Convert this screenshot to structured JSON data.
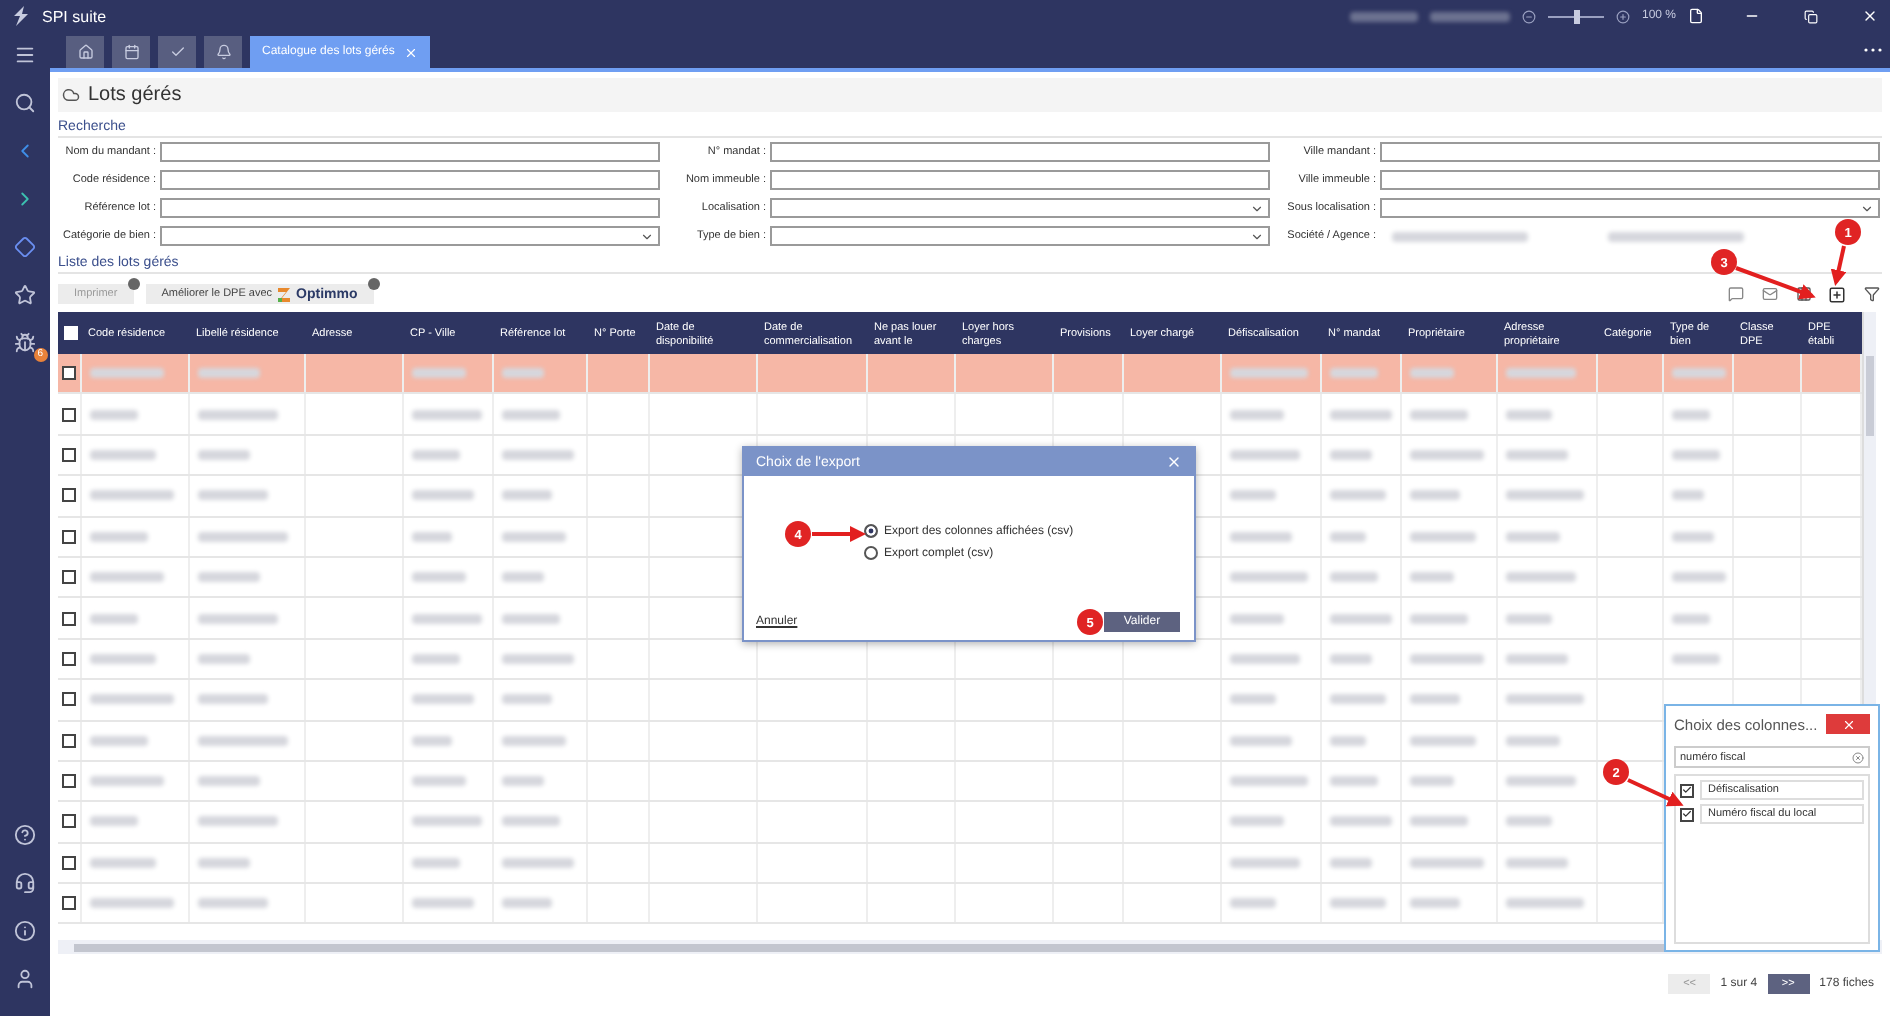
{
  "window": {
    "title": "SPI suite",
    "zoom": {
      "level": 0.5,
      "reading": "100 %"
    }
  },
  "tabs": [
    {
      "kind": "home",
      "selected": false
    },
    {
      "kind": "calendar",
      "selected": false
    },
    {
      "kind": "check",
      "selected": false
    },
    {
      "kind": "bell",
      "selected": false
    },
    {
      "kind": "label",
      "label": "Catalogue des lots gérés",
      "selected": true
    }
  ],
  "sidebar": {
    "items": [
      {
        "kind": "search"
      },
      {
        "kind": "chevron-left"
      },
      {
        "kind": "chevron-right"
      },
      {
        "kind": "diamond"
      },
      {
        "kind": "star"
      },
      {
        "kind": "bug",
        "badge": "6"
      }
    ],
    "bottom_items": [
      {
        "kind": "help"
      },
      {
        "kind": "headset"
      },
      {
        "kind": "info"
      },
      {
        "kind": "user"
      }
    ]
  },
  "page": {
    "title": "Lots gérés"
  },
  "search": {
    "title": "Recherche",
    "fields": [
      {
        "label": "Nom du mandant :",
        "kind": "text"
      },
      {
        "label": "N° mandat :",
        "kind": "text"
      },
      {
        "label": "Ville mandant :",
        "kind": "text"
      },
      {
        "label": "Code résidence :",
        "kind": "text"
      },
      {
        "label": "Nom immeuble :",
        "kind": "text"
      },
      {
        "label": "Ville immeuble :",
        "kind": "text"
      },
      {
        "label": "Référence lot :",
        "kind": "text"
      },
      {
        "label": "Localisation :",
        "kind": "select"
      },
      {
        "label": "Sous localisation :",
        "kind": "select"
      },
      {
        "label": "Catégorie de bien :",
        "kind": "select"
      },
      {
        "label": "Type de bien :",
        "kind": "select"
      },
      {
        "label": "Société / Agence :",
        "kind": "redacted"
      }
    ]
  },
  "list": {
    "title": "Liste des lots gérés",
    "buttons": [
      {
        "label": "Imprimer",
        "disabled": true
      },
      {
        "label": "Améliorer le DPE avec",
        "disabled": false,
        "logo_text": "Optimmo"
      }
    ]
  },
  "table": {
    "select_all_checked": false,
    "columns": [
      "Code résidence",
      "Libellé résidence",
      "Adresse",
      "CP - Ville",
      "Référence lot",
      "N° Porte",
      "Date de disponibilité",
      "Date de commercialisation",
      "Ne pas louer avant le",
      "Loyer hors charges",
      "Provisions",
      "Loyer chargé",
      "Défiscalisation",
      "N° mandat",
      "Propriétaire",
      "Adresse propriétaire",
      "Catégorie",
      "Type de bien",
      "Classe DPE",
      "DPE établi"
    ],
    "rows": [
      {
        "selected": true
      },
      {
        "selected": false
      },
      {
        "selected": false
      },
      {
        "selected": false
      },
      {
        "selected": false
      },
      {
        "selected": false
      },
      {
        "selected": false
      },
      {
        "selected": false
      },
      {
        "selected": false
      },
      {
        "selected": false
      },
      {
        "selected": false
      },
      {
        "selected": false
      },
      {
        "selected": false
      },
      {
        "selected": false
      }
    ]
  },
  "pagination": {
    "previous": {
      "label": "<<",
      "disabled": true
    },
    "page": "1 sur 4",
    "next": {
      "label": ">>",
      "disabled": false
    },
    "total": "178 fiches"
  },
  "export_dialog": {
    "title": "Choix de l'export",
    "options": [
      {
        "label": "Export des colonnes affichées (csv)",
        "selected": true
      },
      {
        "label": "Export complet (csv)",
        "selected": false
      }
    ],
    "cancel": "Annuler",
    "confirm": "Valider"
  },
  "column_chooser": {
    "title": "Choix des colonnes...",
    "search_value": "numéro fiscal",
    "items": [
      {
        "label": "Défiscalisation",
        "checked": true
      },
      {
        "label": "Numéro fiscal du local",
        "checked": true
      }
    ]
  },
  "annotations": [
    {
      "label": "1"
    },
    {
      "label": "2"
    },
    {
      "label": "3"
    },
    {
      "label": "4"
    },
    {
      "label": "5"
    }
  ]
}
